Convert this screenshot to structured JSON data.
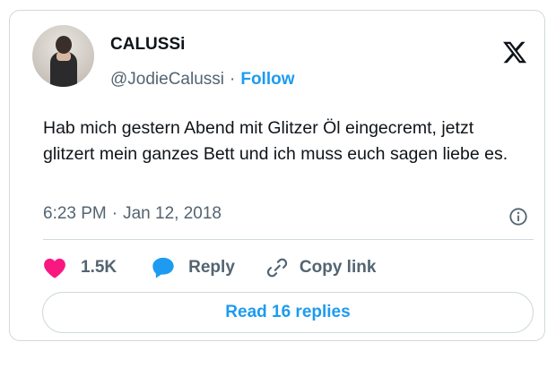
{
  "author": {
    "display_name": "CALUSSi",
    "handle": "@JodieCalussi",
    "separator": "·",
    "follow_label": "Follow"
  },
  "tweet": {
    "text": "Hab mich gestern Abend mit Glitzer Öl eingecremt, jetzt glitzert mein ganzes Bett und ich muss euch sagen liebe es.",
    "time": "6:23 PM",
    "separator": "·",
    "date": "Jan 12, 2018"
  },
  "actions": {
    "like_count": "1.5K",
    "reply_label": "Reply",
    "copy_label": "Copy link"
  },
  "footer": {
    "read_replies_label": "Read 16 replies"
  },
  "colors": {
    "brand_blue": "#1d9bf0",
    "like_pink": "#f91880",
    "text_primary": "#0f1419",
    "text_secondary": "#536471",
    "border": "#cfd9de"
  },
  "icons": {
    "logo": "x-logo-icon",
    "info": "info-icon",
    "like": "heart-icon",
    "reply": "speech-bubble-icon",
    "copy": "link-icon"
  }
}
